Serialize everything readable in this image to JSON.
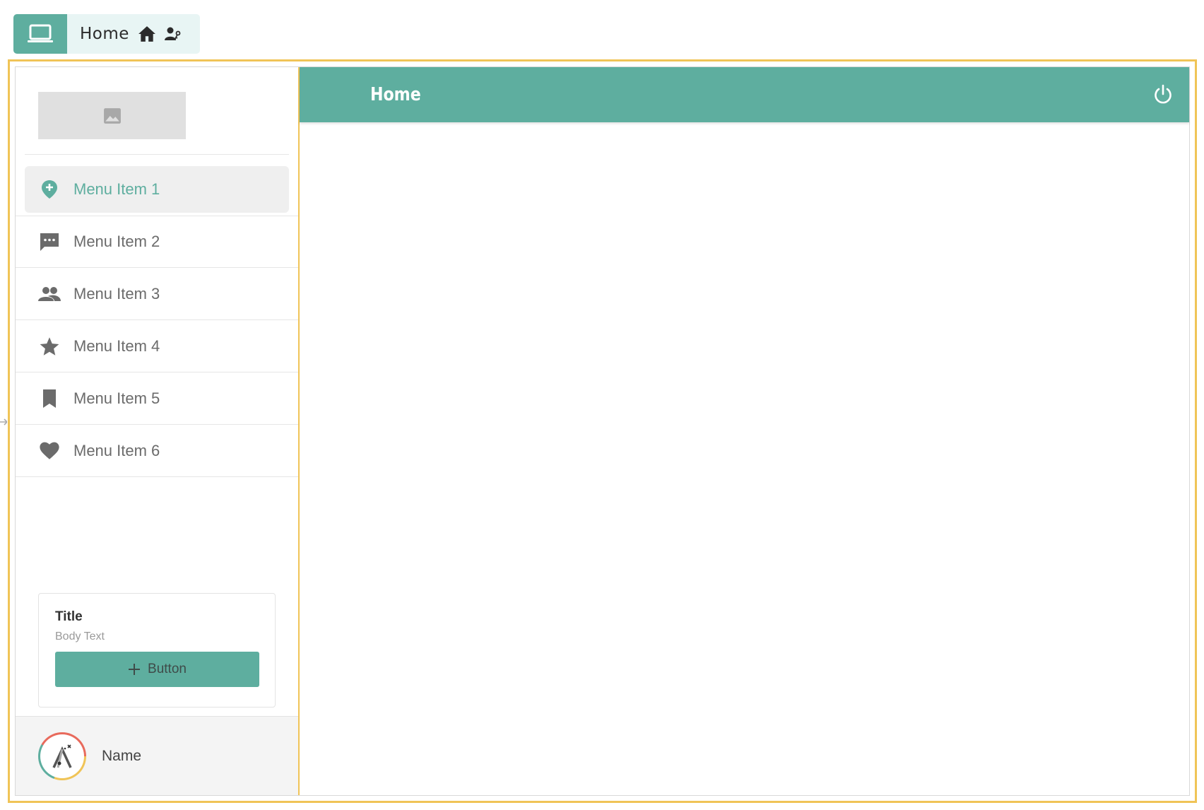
{
  "breadcrumb": {
    "title": "Home",
    "icons": [
      "laptop-icon",
      "home-icon",
      "user-key-icon"
    ]
  },
  "sidebar": {
    "items": [
      {
        "label": "Menu Item 1",
        "icon": "map-pin-plus-icon",
        "active": true
      },
      {
        "label": "Menu Item 2",
        "icon": "chat-icon",
        "active": false
      },
      {
        "label": "Menu Item 3",
        "icon": "people-icon",
        "active": false
      },
      {
        "label": "Menu Item 4",
        "icon": "star-icon",
        "active": false
      },
      {
        "label": "Menu Item 5",
        "icon": "bookmark-icon",
        "active": false
      },
      {
        "label": "Menu Item 6",
        "icon": "heart-icon",
        "active": false
      }
    ],
    "card": {
      "title": "Title",
      "body": "Body Text",
      "button_label": "Button"
    },
    "user": {
      "name": "Name"
    }
  },
  "header": {
    "title": "Home"
  },
  "colors": {
    "accent": "#5eae9f",
    "frame": "#f0c457",
    "active_bg": "#efefef",
    "icon_gray": "#6b6b6b"
  }
}
